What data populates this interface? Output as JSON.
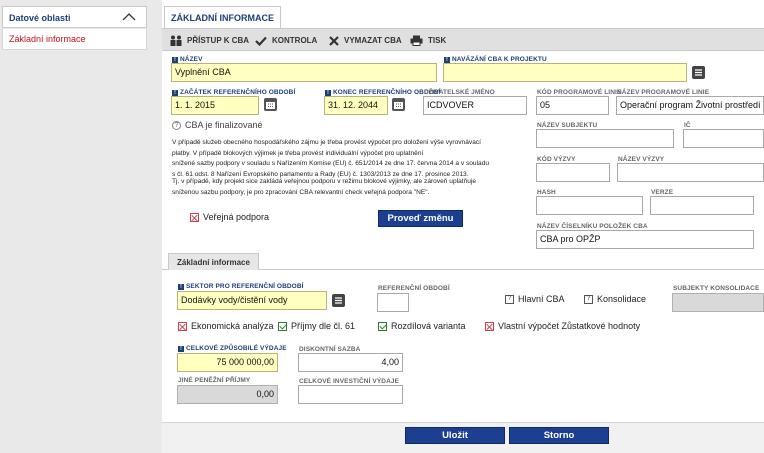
{
  "sidebar": {
    "header": "Datové oblasti",
    "items": [
      {
        "label": "Základní informace"
      }
    ]
  },
  "main": {
    "tab": "ZÁKLADNÍ INFORMACE",
    "toolbar": {
      "pristup": "PŘÍSTUP K CBA",
      "kontrola": "KONTROLA",
      "vymazat": "VYMAZAT CBA",
      "tisk": "TISK"
    }
  },
  "form": {
    "nazev": {
      "label": "NÁZEV",
      "value": "Vyplnění CBA"
    },
    "navazani": {
      "label": "NAVÁZÁNÍ CBA K PROJEKTU",
      "value": ""
    },
    "zacatek": {
      "label": "ZAČÁTEK REFERENČNÍHO OBDOBÍ",
      "value": "1. 1. 2015"
    },
    "konec": {
      "label": "KONEC REFERENČNÍHO OBDOBÍ",
      "value": "31. 12. 2044"
    },
    "uzivatel": {
      "label": "UŽIVATELSKÉ JMÉNO",
      "value": "ICDVOVER"
    },
    "kod_programove_linie": {
      "label": "KÓD PROGRAMOVÉ LINIE",
      "value": "05"
    },
    "nazev_programove_linie": {
      "label": "NÁZEV PROGRAMOVÉ LINIE",
      "value": "Operační program Životní prostředí"
    },
    "finalizovano": "CBA je finalizované",
    "nazev_subjektu": {
      "label": "NÁZEV SUBJEKTU",
      "value": ""
    },
    "ic": {
      "label": "IČ",
      "value": ""
    },
    "kod_vyzvy": {
      "label": "KÓD VÝZVY",
      "value": ""
    },
    "nazev_vyzvy": {
      "label": "NÁZEV VÝZVY",
      "value": ""
    },
    "hash": {
      "label": "HASH",
      "value": ""
    },
    "verze": {
      "label": "VERZE",
      "value": ""
    },
    "ciselnik": {
      "label": "NÁZEV ČÍSELNÍKU POLOŽEK CBA",
      "value": "CBA pro OPŽP"
    },
    "note_lines": [
      "V případě služeb obecného hospodářského zájmu je třeba provést výpočet pro doložení výše vyrovnávací",
      "platby. V případě blokových výjimek je třeba provést individuální výpočet pro uplatnění",
      "snížené sazby podpory v souladu s Nařízením Komise (EU) č. 651/2014 ze dne 17. června 2014 a v souladu",
      "s čl. 61 odst. 8 Nařízení Evropského parlamentu a Rady (EU) č. 1303/2013 ze dne 17. prosince 2013.",
      "Tj. v případě, kdy projekt sice zakládá veřejnou podporu v režimu blokové výjimky, ale zároveň uplatňuje",
      "sníženou sazbu podpory, je pro zpracování CBA relevantní check veřejná podpora \"NE\"."
    ],
    "verejna_podpora": "Veřejná podpora",
    "proved_zmenu": "Proveď změnu"
  },
  "sub": {
    "tab": "Základní informace",
    "sektor": {
      "label": "SEKTOR PRO REFERENČNÍ OBDOBÍ",
      "value": "Dodávky vody/čistění vody"
    },
    "referencni_obdobi": {
      "label": "REFERENČNÍ OBDOBÍ",
      "value": ""
    },
    "hlavni_cba": "Hlavní CBA",
    "konsolidace": "Konsolidace",
    "subjekty": {
      "label": "SUBJEKTY KONSOLIDACE",
      "value": ""
    },
    "ekonomicka": "Ekonomická analýza",
    "prijmy": "Příjmy dle čl. 61",
    "rozdilova": "Rozdílová varianta",
    "vlastni": "Vlastní výpočet Zůstatkové hodnoty",
    "celkove": {
      "label": "CELKOVÉ ZPŮSOBILÉ VÝDAJE",
      "value": "75 000 000,00"
    },
    "diskontni": {
      "label": "DISKONTNÍ SAZBA",
      "value": "4,00"
    },
    "jine": {
      "label": "JINÉ PENĚŽNÍ PŘÍJMY",
      "value": "0,00"
    },
    "investicni": {
      "label": "CELKOVÉ INVESTIČNÍ VÝDAJE",
      "value": ""
    }
  },
  "footer": {
    "ulozit": "Uložit",
    "storno": "Storno"
  }
}
